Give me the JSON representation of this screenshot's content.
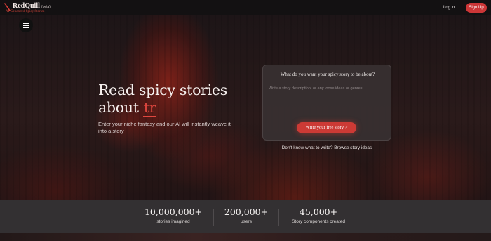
{
  "header": {
    "brand": "RedQuill",
    "beta": "(beta)",
    "tagline": "AI-Generated Spicy Stories",
    "login_label": "Log in",
    "signup_label": "Sign Up"
  },
  "hero": {
    "title_line1": "Read spicy stories",
    "title_line2_prefix": "about",
    "typed_text": "tr",
    "subtitle": "Enter your niche fantasy and our AI will instantly weave it into a story"
  },
  "story_form": {
    "question": "What do you want your spicy story to be about?",
    "placeholder": "Write a story description, or any loose ideas or genres",
    "value": "",
    "cta_label": "Write your free story >",
    "browse_text": "Don't know what to write? Browse story ideas"
  },
  "stats": [
    {
      "value": "10,000,000+",
      "label": "stories imagined"
    },
    {
      "value": "200,000+",
      "label": "users"
    },
    {
      "value": "45,000+",
      "label": "Story components created"
    }
  ],
  "icons": {
    "logo": "quill-icon",
    "menu": "hamburger-menu-icon"
  },
  "colors": {
    "accent": "#cc3637",
    "header_bg": "#131112",
    "stats_bg": "#333032"
  }
}
